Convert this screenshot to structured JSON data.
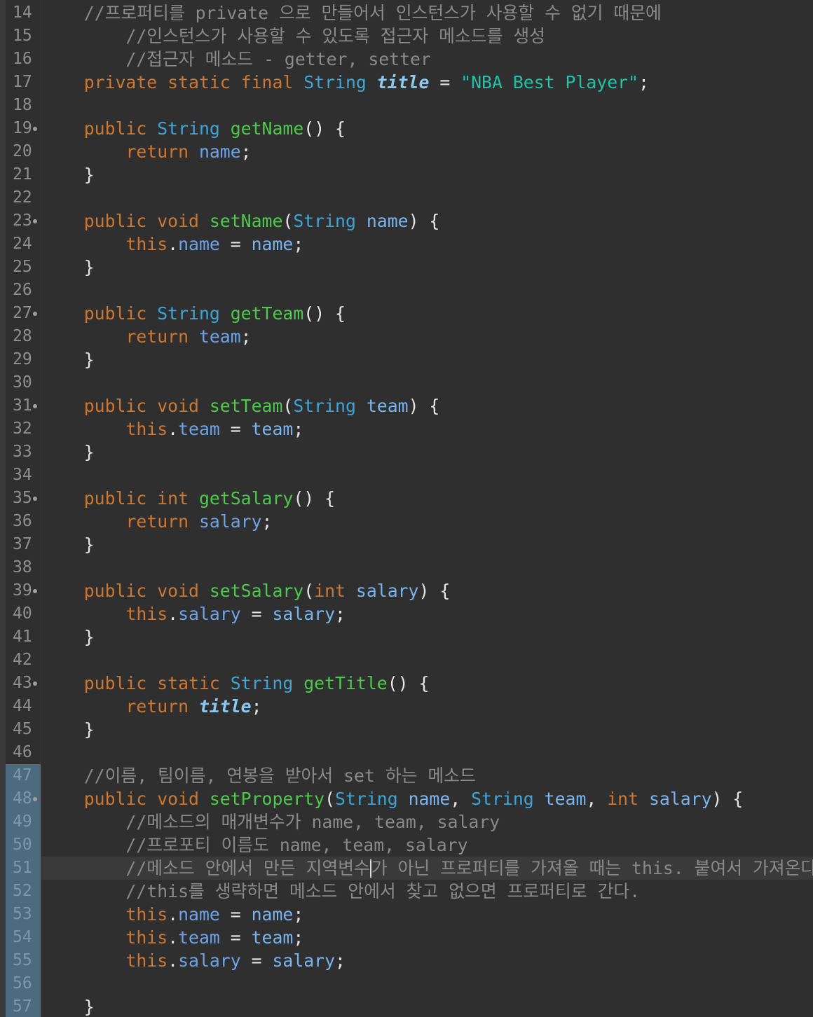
{
  "editor": {
    "lines": [
      {
        "n": "14",
        "fold": false,
        "sel": false,
        "current": false,
        "segs": [
          [
            "comment",
            "    //프로퍼티를 private 으로 만들어서 인스턴스가 사용할 수 없기 때문에"
          ]
        ]
      },
      {
        "n": "15",
        "fold": false,
        "sel": false,
        "current": false,
        "segs": [
          [
            "comment",
            "        //인스턴스가 사용할 수 있도록 접근자 메소드를 생성"
          ]
        ]
      },
      {
        "n": "16",
        "fold": false,
        "sel": false,
        "current": false,
        "segs": [
          [
            "comment",
            "        //접근자 메소드 - getter, setter"
          ]
        ]
      },
      {
        "n": "17",
        "fold": false,
        "sel": false,
        "current": false,
        "segs": [
          [
            "plain",
            "    "
          ],
          [
            "kw",
            "private static final "
          ],
          [
            "type",
            "String "
          ],
          [
            "static",
            "title"
          ],
          [
            "plain",
            " = "
          ],
          [
            "string",
            "\"NBA Best Player\""
          ],
          [
            "plain",
            ";"
          ]
        ]
      },
      {
        "n": "18",
        "fold": false,
        "sel": false,
        "current": false,
        "segs": []
      },
      {
        "n": "19",
        "fold": true,
        "sel": false,
        "current": false,
        "segs": [
          [
            "plain",
            "    "
          ],
          [
            "kw",
            "public "
          ],
          [
            "type",
            "String "
          ],
          [
            "method",
            "getName"
          ],
          [
            "plain",
            "() {"
          ]
        ]
      },
      {
        "n": "20",
        "fold": false,
        "sel": false,
        "current": false,
        "segs": [
          [
            "plain",
            "        "
          ],
          [
            "kw",
            "return "
          ],
          [
            "field",
            "name"
          ],
          [
            "plain",
            ";"
          ]
        ]
      },
      {
        "n": "21",
        "fold": false,
        "sel": false,
        "current": false,
        "segs": [
          [
            "plain",
            "    }"
          ]
        ]
      },
      {
        "n": "22",
        "fold": false,
        "sel": false,
        "current": false,
        "segs": []
      },
      {
        "n": "23",
        "fold": true,
        "sel": false,
        "current": false,
        "segs": [
          [
            "plain",
            "    "
          ],
          [
            "kw",
            "public void "
          ],
          [
            "method",
            "setName"
          ],
          [
            "plain",
            "("
          ],
          [
            "type",
            "String "
          ],
          [
            "param",
            "name"
          ],
          [
            "plain",
            ") {"
          ]
        ]
      },
      {
        "n": "24",
        "fold": false,
        "sel": false,
        "current": false,
        "segs": [
          [
            "plain",
            "        "
          ],
          [
            "kw",
            "this"
          ],
          [
            "plain",
            "."
          ],
          [
            "field",
            "name"
          ],
          [
            "plain",
            " = "
          ],
          [
            "param",
            "name"
          ],
          [
            "plain",
            ";"
          ]
        ]
      },
      {
        "n": "25",
        "fold": false,
        "sel": false,
        "current": false,
        "segs": [
          [
            "plain",
            "    }"
          ]
        ]
      },
      {
        "n": "26",
        "fold": false,
        "sel": false,
        "current": false,
        "segs": []
      },
      {
        "n": "27",
        "fold": true,
        "sel": false,
        "current": false,
        "segs": [
          [
            "plain",
            "    "
          ],
          [
            "kw",
            "public "
          ],
          [
            "type",
            "String "
          ],
          [
            "method",
            "getTeam"
          ],
          [
            "plain",
            "() {"
          ]
        ]
      },
      {
        "n": "28",
        "fold": false,
        "sel": false,
        "current": false,
        "segs": [
          [
            "plain",
            "        "
          ],
          [
            "kw",
            "return "
          ],
          [
            "field",
            "team"
          ],
          [
            "plain",
            ";"
          ]
        ]
      },
      {
        "n": "29",
        "fold": false,
        "sel": false,
        "current": false,
        "segs": [
          [
            "plain",
            "    }"
          ]
        ]
      },
      {
        "n": "30",
        "fold": false,
        "sel": false,
        "current": false,
        "segs": []
      },
      {
        "n": "31",
        "fold": true,
        "sel": false,
        "current": false,
        "segs": [
          [
            "plain",
            "    "
          ],
          [
            "kw",
            "public void "
          ],
          [
            "method",
            "setTeam"
          ],
          [
            "plain",
            "("
          ],
          [
            "type",
            "String "
          ],
          [
            "param",
            "team"
          ],
          [
            "plain",
            ") {"
          ]
        ]
      },
      {
        "n": "32",
        "fold": false,
        "sel": false,
        "current": false,
        "segs": [
          [
            "plain",
            "        "
          ],
          [
            "kw",
            "this"
          ],
          [
            "plain",
            "."
          ],
          [
            "field",
            "team"
          ],
          [
            "plain",
            " = "
          ],
          [
            "param",
            "team"
          ],
          [
            "plain",
            ";"
          ]
        ]
      },
      {
        "n": "33",
        "fold": false,
        "sel": false,
        "current": false,
        "segs": [
          [
            "plain",
            "    }"
          ]
        ]
      },
      {
        "n": "34",
        "fold": false,
        "sel": false,
        "current": false,
        "segs": []
      },
      {
        "n": "35",
        "fold": true,
        "sel": false,
        "current": false,
        "segs": [
          [
            "plain",
            "    "
          ],
          [
            "kw",
            "public int "
          ],
          [
            "method",
            "getSalary"
          ],
          [
            "plain",
            "() {"
          ]
        ]
      },
      {
        "n": "36",
        "fold": false,
        "sel": false,
        "current": false,
        "segs": [
          [
            "plain",
            "        "
          ],
          [
            "kw",
            "return "
          ],
          [
            "field",
            "salary"
          ],
          [
            "plain",
            ";"
          ]
        ]
      },
      {
        "n": "37",
        "fold": false,
        "sel": false,
        "current": false,
        "segs": [
          [
            "plain",
            "    }"
          ]
        ]
      },
      {
        "n": "38",
        "fold": false,
        "sel": false,
        "current": false,
        "segs": []
      },
      {
        "n": "39",
        "fold": true,
        "sel": false,
        "current": false,
        "segs": [
          [
            "plain",
            "    "
          ],
          [
            "kw",
            "public void "
          ],
          [
            "method",
            "setSalary"
          ],
          [
            "plain",
            "("
          ],
          [
            "kw",
            "int "
          ],
          [
            "param",
            "salary"
          ],
          [
            "plain",
            ") {"
          ]
        ]
      },
      {
        "n": "40",
        "fold": false,
        "sel": false,
        "current": false,
        "segs": [
          [
            "plain",
            "        "
          ],
          [
            "kw",
            "this"
          ],
          [
            "plain",
            "."
          ],
          [
            "field",
            "salary"
          ],
          [
            "plain",
            " = "
          ],
          [
            "param",
            "salary"
          ],
          [
            "plain",
            ";"
          ]
        ]
      },
      {
        "n": "41",
        "fold": false,
        "sel": false,
        "current": false,
        "segs": [
          [
            "plain",
            "    }"
          ]
        ]
      },
      {
        "n": "42",
        "fold": false,
        "sel": false,
        "current": false,
        "segs": []
      },
      {
        "n": "43",
        "fold": true,
        "sel": false,
        "current": false,
        "segs": [
          [
            "plain",
            "    "
          ],
          [
            "kw",
            "public static "
          ],
          [
            "type",
            "String "
          ],
          [
            "method",
            "getTitle"
          ],
          [
            "plain",
            "() {"
          ]
        ]
      },
      {
        "n": "44",
        "fold": false,
        "sel": false,
        "current": false,
        "segs": [
          [
            "plain",
            "        "
          ],
          [
            "kw",
            "return "
          ],
          [
            "static",
            "title"
          ],
          [
            "plain",
            ";"
          ]
        ]
      },
      {
        "n": "45",
        "fold": false,
        "sel": false,
        "current": false,
        "segs": [
          [
            "plain",
            "    }"
          ]
        ]
      },
      {
        "n": "46",
        "fold": false,
        "sel": false,
        "current": false,
        "segs": []
      },
      {
        "n": "47",
        "fold": false,
        "sel": true,
        "current": false,
        "segs": [
          [
            "comment",
            "    //이름, 팀이름, 연봉을 받아서 set 하는 메소드"
          ]
        ]
      },
      {
        "n": "48",
        "fold": true,
        "sel": true,
        "current": false,
        "segs": [
          [
            "plain",
            "    "
          ],
          [
            "kw",
            "public void "
          ],
          [
            "method",
            "setProperty"
          ],
          [
            "plain",
            "("
          ],
          [
            "type",
            "String "
          ],
          [
            "param",
            "name"
          ],
          [
            "plain",
            ", "
          ],
          [
            "type",
            "String "
          ],
          [
            "param",
            "team"
          ],
          [
            "plain",
            ", "
          ],
          [
            "kw",
            "int "
          ],
          [
            "param",
            "salary"
          ],
          [
            "plain",
            ") {"
          ]
        ]
      },
      {
        "n": "49",
        "fold": false,
        "sel": true,
        "current": false,
        "segs": [
          [
            "comment",
            "        //메소드의 매개변수가 name, team, salary"
          ]
        ]
      },
      {
        "n": "50",
        "fold": false,
        "sel": true,
        "current": false,
        "segs": [
          [
            "comment",
            "        //프로포티 이름도 name, team, salary"
          ]
        ]
      },
      {
        "n": "51",
        "fold": false,
        "sel": true,
        "current": true,
        "segs": [
          [
            "comment",
            "        //메소드 안에서 만든 지역변수"
          ],
          [
            "caret",
            ""
          ],
          [
            "comment",
            "가 아닌 프로퍼티를 가져올 때는 this. 붙여서 가져온다."
          ]
        ]
      },
      {
        "n": "52",
        "fold": false,
        "sel": true,
        "current": false,
        "segs": [
          [
            "comment",
            "        //this를 생략하면 메소드 안에서 찾고 없으면 프로퍼티로 간다."
          ]
        ]
      },
      {
        "n": "53",
        "fold": false,
        "sel": true,
        "current": false,
        "segs": [
          [
            "plain",
            "        "
          ],
          [
            "kw",
            "this"
          ],
          [
            "plain",
            "."
          ],
          [
            "field",
            "name"
          ],
          [
            "plain",
            " = "
          ],
          [
            "param",
            "name"
          ],
          [
            "plain",
            ";"
          ]
        ]
      },
      {
        "n": "54",
        "fold": false,
        "sel": true,
        "current": false,
        "segs": [
          [
            "plain",
            "        "
          ],
          [
            "kw",
            "this"
          ],
          [
            "plain",
            "."
          ],
          [
            "field",
            "team"
          ],
          [
            "plain",
            " = "
          ],
          [
            "param",
            "team"
          ],
          [
            "plain",
            ";"
          ]
        ]
      },
      {
        "n": "55",
        "fold": false,
        "sel": true,
        "current": false,
        "segs": [
          [
            "plain",
            "        "
          ],
          [
            "kw",
            "this"
          ],
          [
            "plain",
            "."
          ],
          [
            "field",
            "salary"
          ],
          [
            "plain",
            " = "
          ],
          [
            "param",
            "salary"
          ],
          [
            "plain",
            ";"
          ]
        ]
      },
      {
        "n": "56",
        "fold": false,
        "sel": true,
        "current": false,
        "segs": []
      },
      {
        "n": "57",
        "fold": false,
        "sel": true,
        "current": false,
        "segs": [
          [
            "plain",
            "    }"
          ]
        ]
      }
    ]
  }
}
